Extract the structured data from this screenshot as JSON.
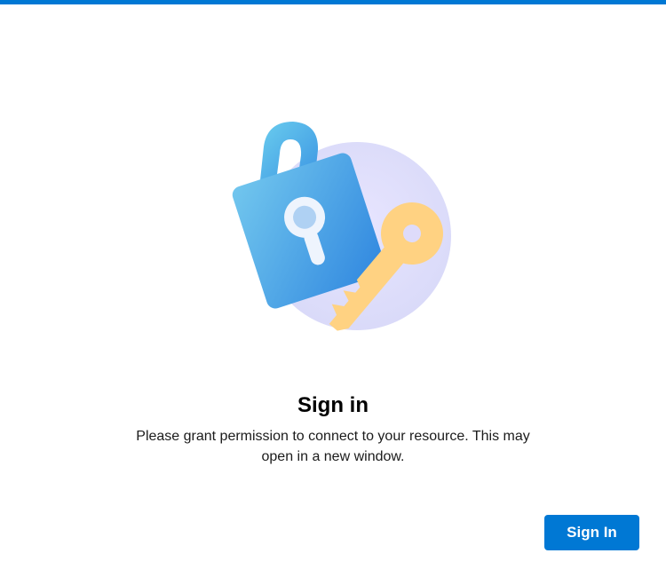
{
  "dialog": {
    "title": "Sign in",
    "message": "Please grant permission to connect to your resource. This may open in a new window."
  },
  "actions": {
    "sign_in_label": "Sign In"
  },
  "icons": {
    "illustration": "lock-and-key-icon"
  },
  "colors": {
    "accent": "#0078d4",
    "lock_light": "#72c7ee",
    "lock_dark": "#2f86df",
    "circle": "#dedbfa",
    "key": "#ffd282"
  }
}
